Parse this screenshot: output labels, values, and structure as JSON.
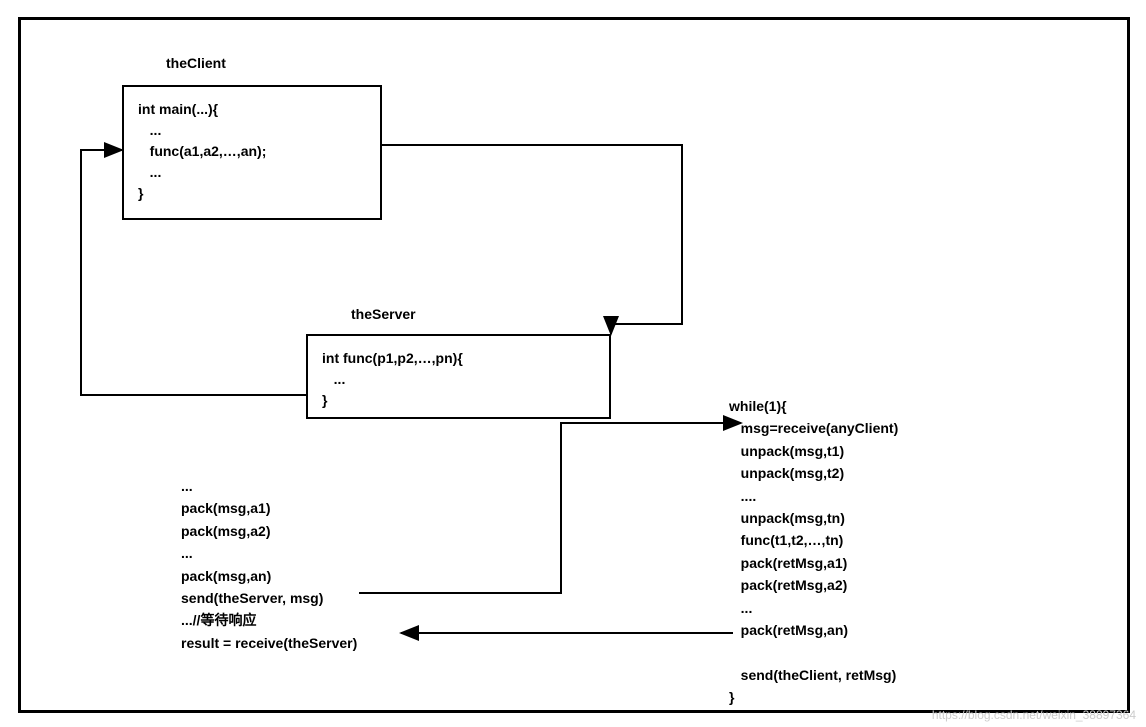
{
  "client": {
    "label": "theClient",
    "code": "int main(...){\n   ...\n   func(a1,a2,…,an);\n   ...\n}"
  },
  "server": {
    "label": "theServer",
    "code": "int func(p1,p2,…,pn){\n   ...\n}"
  },
  "client_stub": {
    "code": "...\npack(msg,a1)\npack(msg,a2)\n...\npack(msg,an)\nsend(theServer, msg)\n...//等待响应\nresult = receive(theServer)"
  },
  "server_loop": {
    "code": "while(1){\n   msg=receive(anyClient)\n   unpack(msg,t1)\n   unpack(msg,t2)\n   ....\n   unpack(msg,tn)\n   func(t1,t2,…,tn)\n   pack(retMsg,a1)\n   pack(retMsg,a2)\n   ...\n   pack(retMsg,an)\n\n   send(theClient, retMsg)\n}"
  },
  "watermark": "https://blog.csdn.net/weixin_38897364"
}
